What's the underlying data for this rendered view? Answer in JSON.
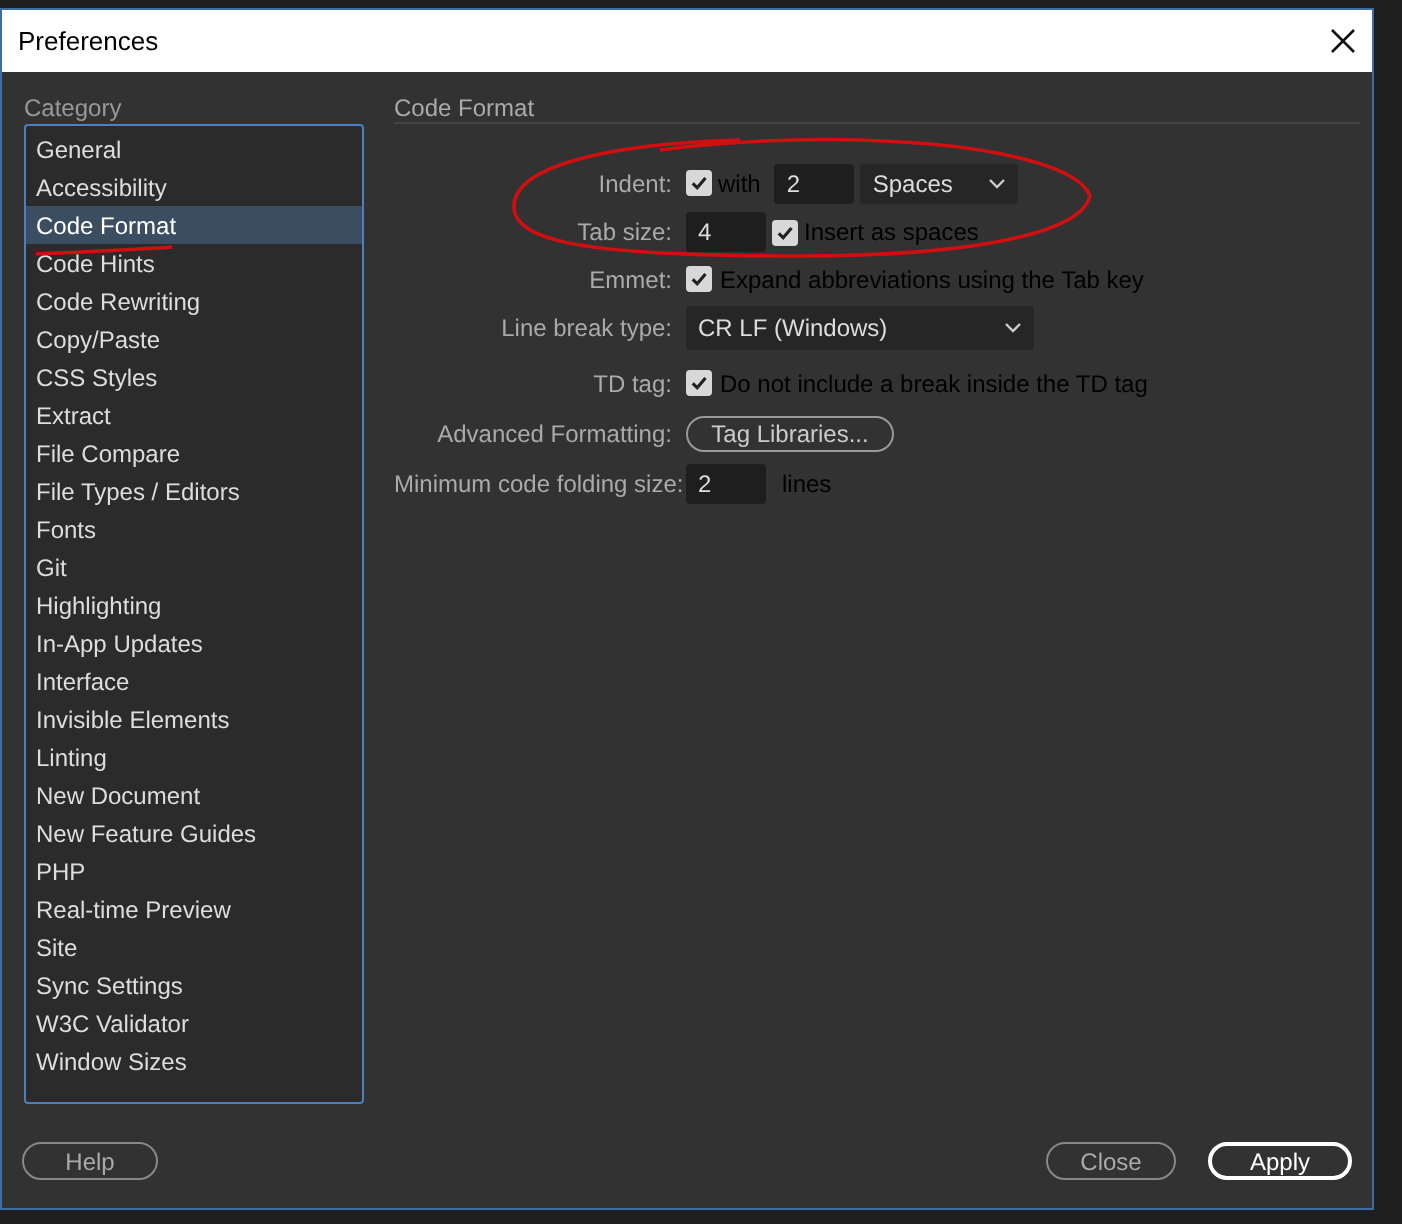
{
  "window": {
    "title": "Preferences"
  },
  "sidebar": {
    "title": "Category",
    "items": [
      {
        "label": "General",
        "selected": false
      },
      {
        "label": "Accessibility",
        "selected": false
      },
      {
        "label": "Code Format",
        "selected": true
      },
      {
        "label": "Code Hints",
        "selected": false
      },
      {
        "label": "Code Rewriting",
        "selected": false
      },
      {
        "label": "Copy/Paste",
        "selected": false
      },
      {
        "label": "CSS Styles",
        "selected": false
      },
      {
        "label": "Extract",
        "selected": false
      },
      {
        "label": "File Compare",
        "selected": false
      },
      {
        "label": "File Types / Editors",
        "selected": false
      },
      {
        "label": "Fonts",
        "selected": false
      },
      {
        "label": "Git",
        "selected": false
      },
      {
        "label": "Highlighting",
        "selected": false
      },
      {
        "label": "In-App Updates",
        "selected": false
      },
      {
        "label": "Interface",
        "selected": false
      },
      {
        "label": "Invisible Elements",
        "selected": false
      },
      {
        "label": "Linting",
        "selected": false
      },
      {
        "label": "New Document",
        "selected": false
      },
      {
        "label": "New Feature Guides",
        "selected": false
      },
      {
        "label": "PHP",
        "selected": false
      },
      {
        "label": "Real-time Preview",
        "selected": false
      },
      {
        "label": "Site",
        "selected": false
      },
      {
        "label": "Sync Settings",
        "selected": false
      },
      {
        "label": "W3C Validator",
        "selected": false
      },
      {
        "label": "Window Sizes",
        "selected": false
      }
    ]
  },
  "panel": {
    "title": "Code Format",
    "settings": [
      {
        "kind": "indent",
        "label": "Indent:",
        "checked": true,
        "text": "with",
        "value": "2",
        "select": "Spaces"
      },
      {
        "kind": "tabsize",
        "label": "Tab size:",
        "value": "4",
        "checked": true,
        "text": "Insert as spaces"
      },
      {
        "kind": "checkbox",
        "label": "Emmet:",
        "checked": true,
        "text": "Expand abbreviations using the Tab key"
      },
      {
        "kind": "select",
        "label": "Line break type:",
        "value": "CR LF (Windows)"
      },
      {
        "kind": "checkbox",
        "label": "TD tag:",
        "checked": true,
        "text": "Do not include a break inside the TD tag"
      },
      {
        "kind": "button",
        "label": "Advanced Formatting:",
        "text": "Tag Libraries..."
      },
      {
        "kind": "number",
        "label": "Minimum code folding size:",
        "value": "2",
        "unit": "lines"
      }
    ]
  },
  "buttons": [
    {
      "label": "Help",
      "kind": "help"
    },
    {
      "label": "Close",
      "kind": "secondary"
    },
    {
      "label": "Apply",
      "kind": "primary"
    }
  ]
}
